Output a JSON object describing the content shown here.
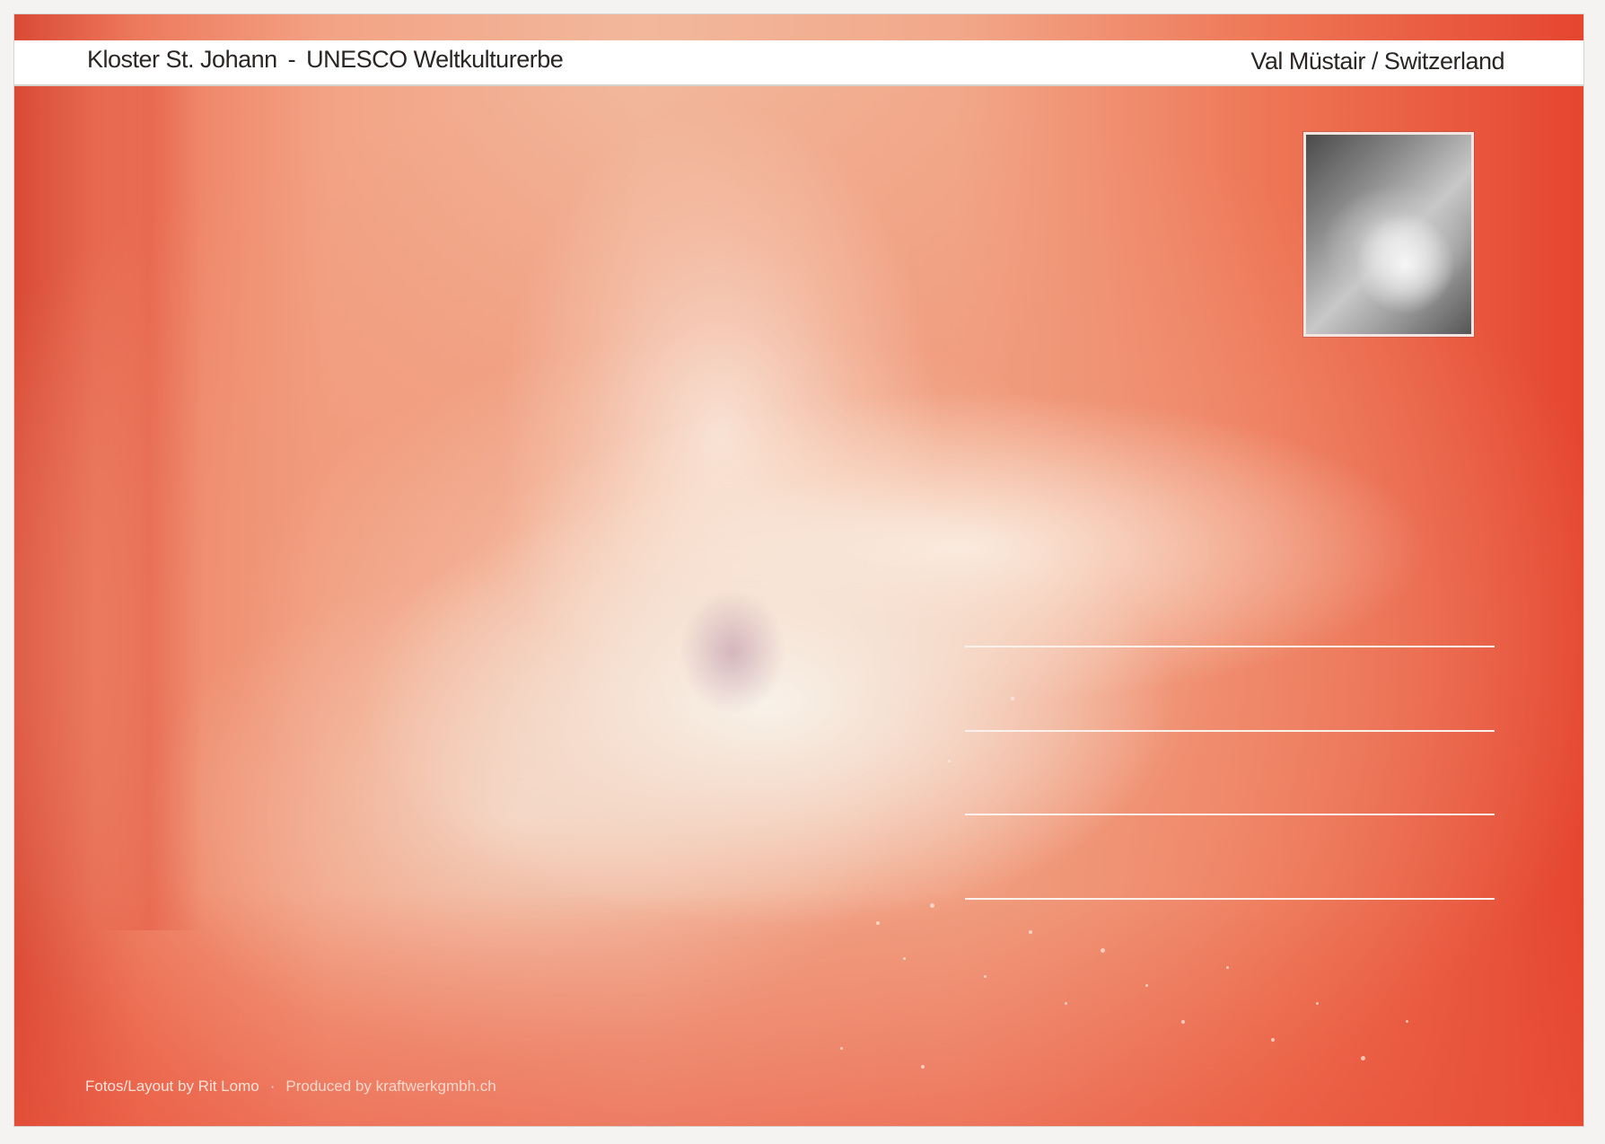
{
  "header": {
    "title": "Kloster St. Johann",
    "separator": "-",
    "subtitle": "UNESCO Weltkulturerbe",
    "location": "Val Müstair / Switzerland"
  },
  "footer": {
    "credit": "Fotos/Layout by Rit Lomo",
    "separator": "·",
    "producer": "Produced by kraftwerkgmbh.ch"
  },
  "colors": {
    "card_red": "#e94a34",
    "header_bar": "#ffffff",
    "address_lines": "#fbf2ee"
  },
  "address": {
    "line_count": 4
  }
}
